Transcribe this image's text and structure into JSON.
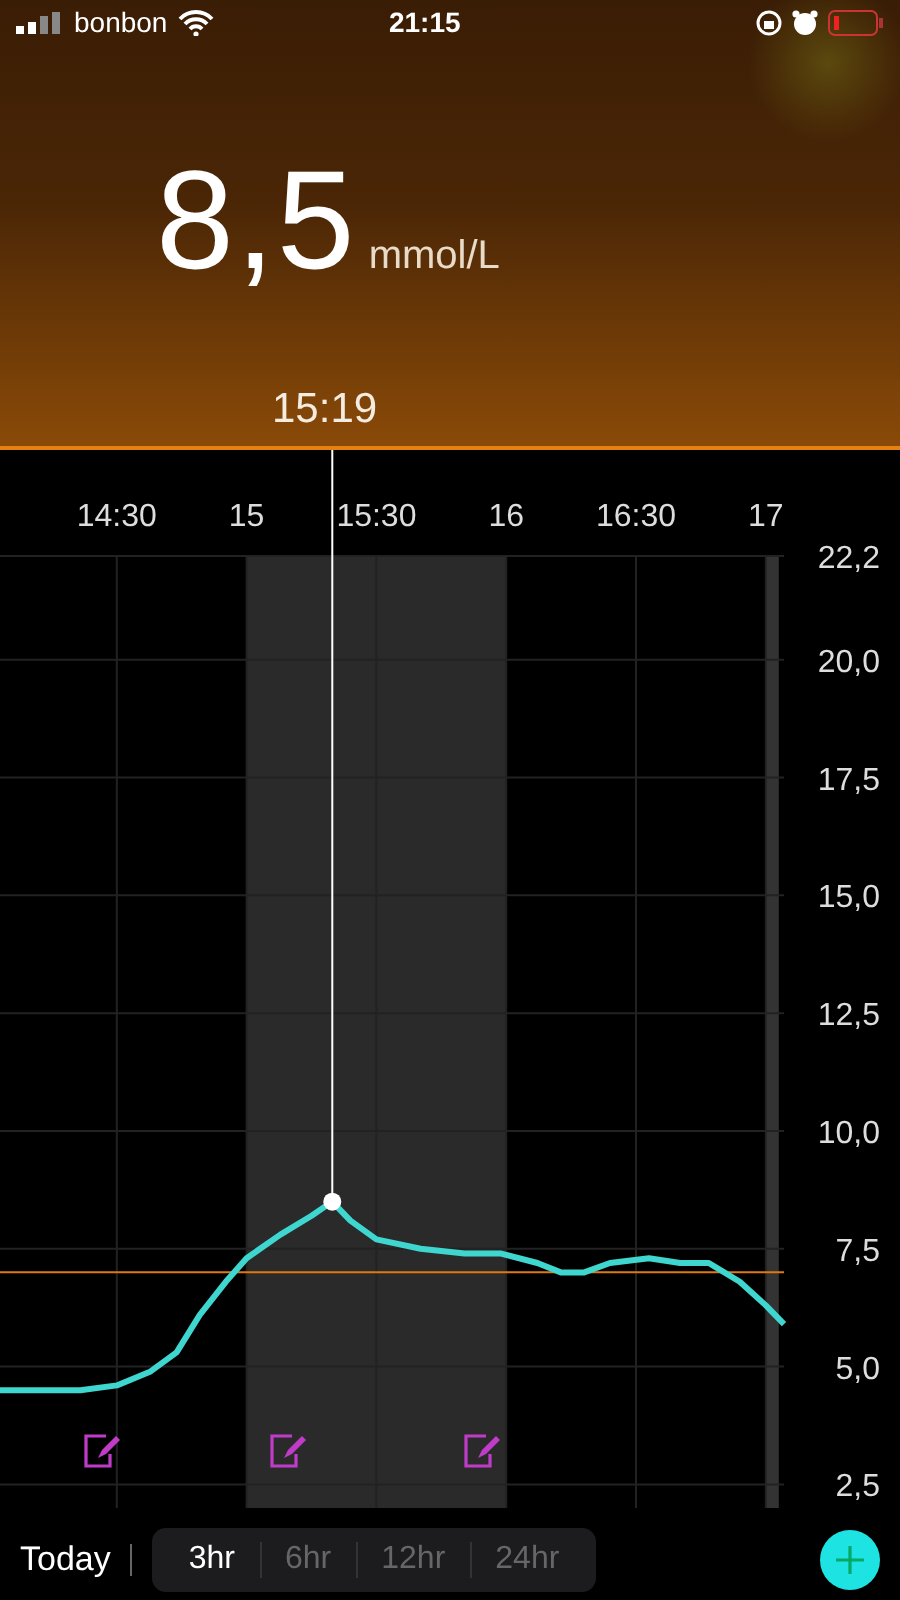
{
  "status_bar": {
    "carrier": "bonbon",
    "time": "21:15"
  },
  "reading": {
    "value": "8,5",
    "unit": "mmol/L",
    "cursor_time": "15:19"
  },
  "chart_data": {
    "type": "line",
    "xlim": [
      14.05,
      17.07
    ],
    "ylim": [
      2.0,
      22.2
    ],
    "xticks": [
      {
        "value": 14.5,
        "label": "14:30"
      },
      {
        "value": 15,
        "label": "15"
      },
      {
        "value": 15.5,
        "label": "15:30"
      },
      {
        "value": 16,
        "label": "16"
      },
      {
        "value": 16.5,
        "label": "16:30"
      },
      {
        "value": 17,
        "label": "17"
      }
    ],
    "yticks": [
      {
        "value": 2.5,
        "label": "2,5"
      },
      {
        "value": 5,
        "label": "5,0"
      },
      {
        "value": 7.5,
        "label": "7,5"
      },
      {
        "value": 10,
        "label": "10,0"
      },
      {
        "value": 12.5,
        "label": "12,5"
      },
      {
        "value": 15,
        "label": "15,0"
      },
      {
        "value": 17.5,
        "label": "17,5"
      },
      {
        "value": 20,
        "label": "20,0"
      },
      {
        "value": 22.2,
        "label": "22,2"
      }
    ],
    "grid": true,
    "series": [
      {
        "color": "#3fd6d0",
        "x": [
          14.05,
          14.36,
          14.5,
          14.63,
          14.73,
          14.82,
          14.92,
          15.0,
          15.13,
          15.25,
          15.33,
          15.4,
          15.5,
          15.67,
          15.84,
          15.98,
          16.12,
          16.21,
          16.3,
          16.4,
          16.55,
          16.67,
          16.78,
          16.9,
          17.0,
          17.07
        ],
        "values": [
          4.5,
          4.5,
          4.6,
          4.9,
          5.3,
          6.1,
          6.8,
          7.3,
          7.8,
          8.2,
          8.5,
          8.1,
          7.7,
          7.5,
          7.4,
          7.4,
          7.2,
          7.0,
          7.0,
          7.2,
          7.3,
          7.2,
          7.2,
          6.8,
          6.3,
          5.9
        ]
      }
    ],
    "bands": [
      {
        "axis": "x",
        "from": 15,
        "to": 16,
        "color": "#2a2a2a"
      },
      {
        "axis": "x",
        "from": 17.0,
        "to": 17.05,
        "color": "#333333"
      }
    ],
    "ref_lines": [
      {
        "axis": "y",
        "value": 7.0,
        "color": "#e07a10"
      }
    ]
  },
  "footer": {
    "today": "Today",
    "tabs": [
      {
        "label": "3hr",
        "selected": true
      },
      {
        "label": "6hr",
        "selected": false
      },
      {
        "label": "12hr",
        "selected": false
      },
      {
        "label": "24hr",
        "selected": false
      }
    ]
  }
}
